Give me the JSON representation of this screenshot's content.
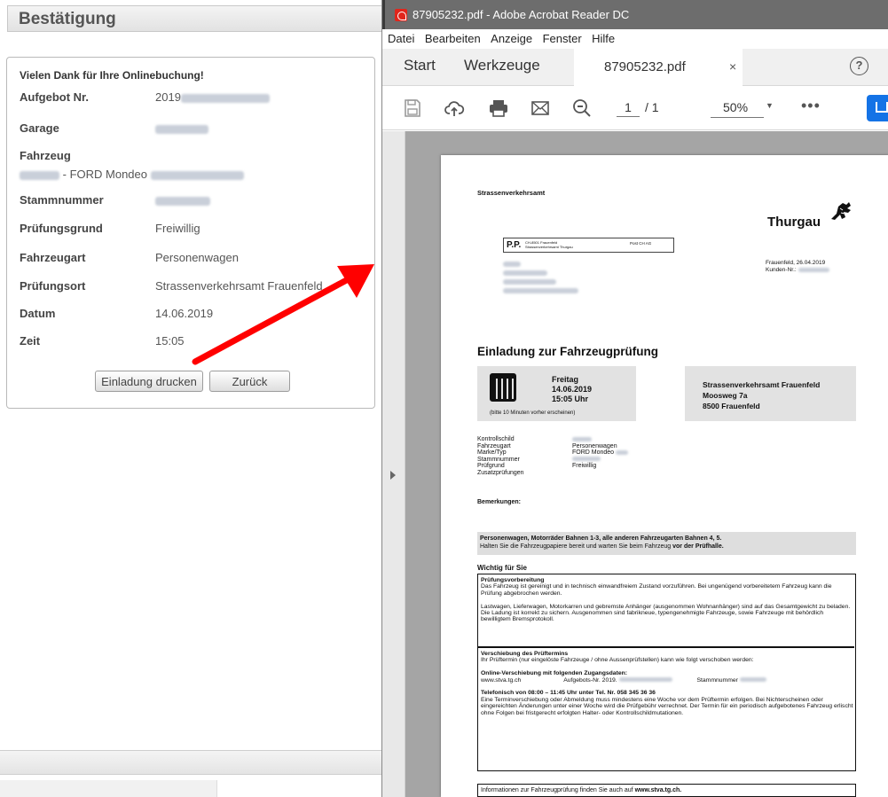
{
  "booking": {
    "header_title": "Bestätigung",
    "thanks": "Vielen Dank für Ihre Onlinebuchung!",
    "rows": [
      {
        "label": "Aufgebot Nr.",
        "value": "2019"
      },
      {
        "label": "Garage",
        "value": ""
      },
      {
        "label": "Fahrzeug",
        "value": ""
      },
      {
        "label": "Stammnummer",
        "value": ""
      },
      {
        "label": "Prüfungsgrund",
        "value": "Freiwillig"
      },
      {
        "label": "Fahrzeugart",
        "value": "Personenwagen"
      },
      {
        "label": "Prüfungsort",
        "value": "Strassenverkehrsamt Frauenfeld"
      },
      {
        "label": "Datum",
        "value": "14.06.2019"
      },
      {
        "label": "Zeit",
        "value": "15:05"
      }
    ],
    "vehicle_model": "- FORD Mondeo",
    "print_button": "Einladung drucken",
    "back_button": "Zurück"
  },
  "acrobat": {
    "window_title": "87905232.pdf - Adobe Acrobat Reader DC",
    "menu": [
      "Datei",
      "Bearbeiten",
      "Anzeige",
      "Fenster",
      "Hilfe"
    ],
    "tabs": {
      "start": "Start",
      "tools": "Werkzeuge",
      "document": "87905232.pdf",
      "close": "×"
    },
    "help": "?",
    "page_current": "1",
    "page_total": "/ 1",
    "zoom": "50%",
    "more": "•••"
  },
  "pdf": {
    "sender": "Strassenverkehrsamt",
    "logo": "Thurgau",
    "pp": "P.P.",
    "pp_address": [
      "CH-8501 Frauenfeld",
      "Strassenverkehrsamt Thurgau"
    ],
    "pp_post": "Post CH AG",
    "place_date": "Frauenfeld,  26.04.2019",
    "customer_no": "Kunden-Nr.:",
    "title": "Einladung zur Fahrzeugprüfung",
    "appointment": {
      "day": "Freitag",
      "date": "14.06.2019",
      "time": "15:05 Uhr",
      "note": "(bitte 10 Minuten vorher erscheinen)"
    },
    "office": [
      "Strassenverkehrsamt Frauenfeld",
      "Moosweg 7a",
      "8500 Frauenfeld"
    ],
    "detail_labels": [
      "Kontrollschild",
      "Fahrzeugart",
      "Marke/Typ",
      "Stammnummer",
      "Prüfgrund",
      "Zusatzprüfungen"
    ],
    "detail_values": [
      "",
      "Personenwagen",
      "FORD Mondeo",
      "",
      "Freiwillig",
      ""
    ],
    "remarks": "Bemerkungen:",
    "lanes_bold": "Personenwagen, Motorräder Bahnen 1-3, alle anderen Fahrzeugarten Bahnen 4, 5.",
    "lanes_text": "Halten Sie die Fahrzeugpapiere bereit und warten Sie beim Fahrzeug",
    "lanes_text_bold": "vor der Prüfhalle.",
    "important": "Wichtig für Sie",
    "prep_title": "Prüfungsvorbereitung",
    "prep_text": "Das Fahrzeug ist gereinigt und in technisch einwandfreiem Zustand vorzuführen. Bei ungenügend vorbereitetem Fahrzeug kann die Prüfung abgebrochen werden.",
    "prep_text2": "Lastwagen, Lieferwagen, Motorkarren und gebremste Anhänger (ausgenommen Wohnanhänger) sind auf das Gesamtgewicht zu beladen. Die Ladung ist korrekt zu sichern. Ausgenommen sind fabrikneue, typengenehmigte Fahrzeuge, sowie Fahrzeuge mit behördlich bewilligtem Bremsprotokoll.",
    "move_title": "Verschiebung des Prüftermins",
    "move_text": "Ihr Prüftermin (nur eingelöste Fahrzeuge / ohne Aussenprüfstellen) kann wie folgt verschoben werden:",
    "online_title": "Online-Verschiebung mit folgenden Zugangsdaten:",
    "online_url": "www.stva.tg.ch",
    "online_no": "Aufgebots-Nr. 2019.",
    "online_stamm": "Stammnummer",
    "phone_title": "Telefonisch von 08:00 – 11:45 Uhr unter Tel. Nr. 058 345 36 36",
    "phone_text": "Eine Terminverschiebung oder Abmeldung muss mindestens eine Woche vor dem Prüftermin erfolgen. Bei Nichterscheinen oder eingereichten Änderungen unter einer Woche wird die Prüfgebühr verrechnet. Der Termin für ein periodisch aufgebotenes Fahrzeug erlischt ohne Folgen bei fristgerecht erfolgten Halter- oder Kontrollschildmutationen.",
    "final_text": "Informationen zur Fahrzeugprüfung finden Sie auch auf",
    "final_url": "www.stva.tg.ch."
  },
  "colors": {
    "arrow": "#ff0000",
    "title_bar": "#6d6d6d",
    "share_button": "#1473e6",
    "acrobat_icon": "#e1251b"
  },
  "icons": [
    "save-icon",
    "cloud-upload-icon",
    "print-icon",
    "mail-icon",
    "zoom-out-icon",
    "share-icon",
    "calendar-icon",
    "thurgau-lion-icon",
    "help-icon"
  ]
}
